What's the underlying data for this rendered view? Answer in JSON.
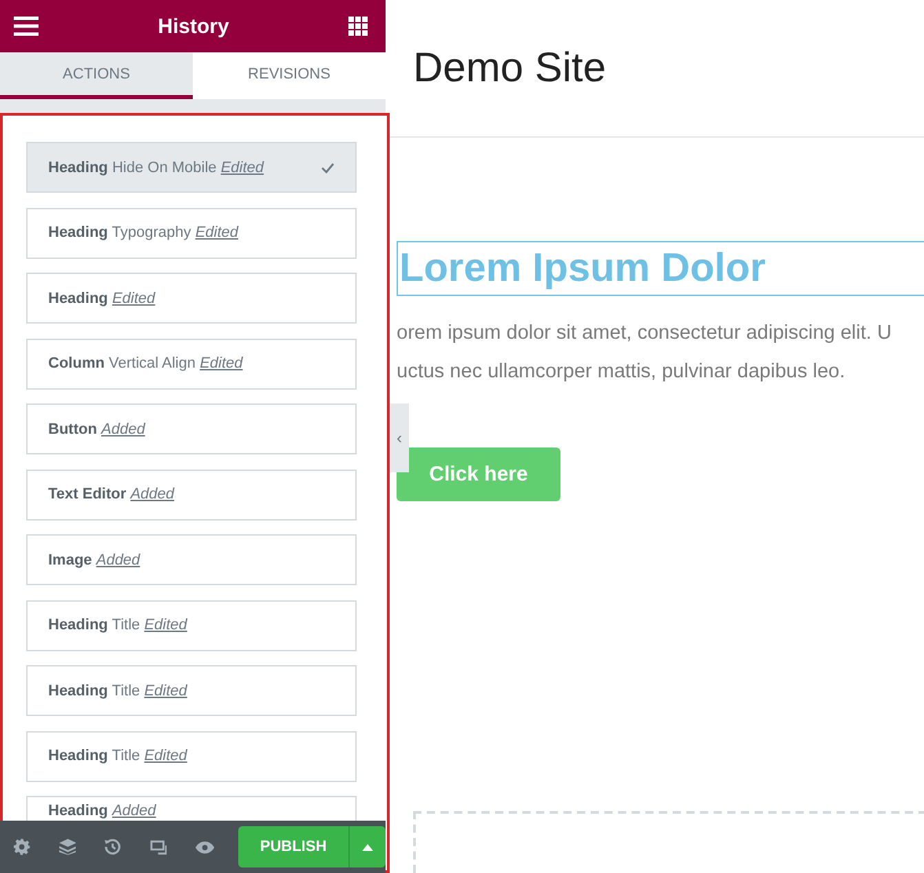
{
  "panel": {
    "title": "History",
    "tabs": [
      {
        "label": "ACTIONS",
        "selected": true
      },
      {
        "label": "REVISIONS",
        "selected": false
      }
    ],
    "actions": [
      {
        "element": "Heading",
        "detail": "Hide On Mobile",
        "status": "Edited",
        "selected": true
      },
      {
        "element": "Heading",
        "detail": "Typography",
        "status": "Edited",
        "selected": false
      },
      {
        "element": "Heading",
        "status": "Edited",
        "selected": false
      },
      {
        "element": "Column",
        "detail": "Vertical Align",
        "status": "Edited",
        "selected": false
      },
      {
        "element": "Button",
        "status": "Added",
        "selected": false
      },
      {
        "element": "Text Editor",
        "status": "Added",
        "selected": false
      },
      {
        "element": "Image",
        "status": "Added",
        "selected": false
      },
      {
        "element": "Heading",
        "detail": "Title",
        "status": "Edited",
        "selected": false
      },
      {
        "element": "Heading",
        "detail": "Title",
        "status": "Edited",
        "selected": false
      },
      {
        "element": "Heading",
        "detail": "Title",
        "status": "Edited",
        "selected": false
      },
      {
        "element": "Heading",
        "status": "Added",
        "selected": false
      }
    ],
    "publish_label": "PUBLISH"
  },
  "canvas": {
    "site_title": "Demo Site",
    "heading": "Lorem Ipsum Dolor",
    "paragraph_lines": [
      "orem ipsum dolor sit amet, consectetur adipiscing elit. U",
      "uctus nec ullamcorper mattis, pulvinar dapibus leo."
    ],
    "collapse_glyph": "‹",
    "button": "Click here"
  }
}
